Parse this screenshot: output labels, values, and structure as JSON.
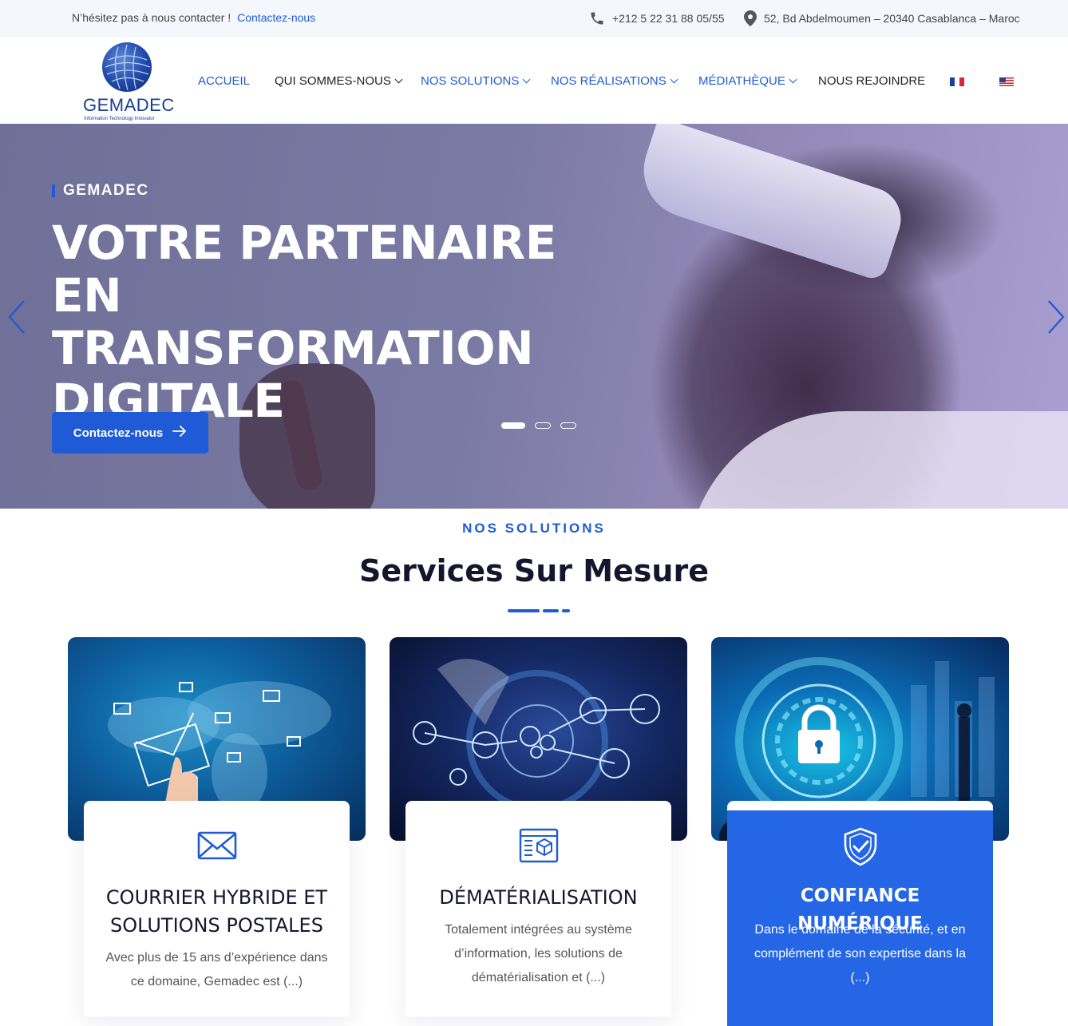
{
  "topbar": {
    "contact_prompt": "N’hésitez pas à nous contacter !",
    "contact_link": "Contactez-nous",
    "phone": "+212 5 22 31 88 05/55",
    "address": "52, Bd Abdelmoumen – 20340 Casablanca – Maroc",
    "icons": [
      "phone-icon",
      "map-pin-icon"
    ]
  },
  "logo": {
    "name": "GEMADEC",
    "tagline": "Information Technology Innovator"
  },
  "nav": {
    "items": [
      {
        "label": "ACCUEIL",
        "dropdown": false
      },
      {
        "label": "QUI SOMMES-NOUS",
        "dropdown": true
      },
      {
        "label": "NOS SOLUTIONS",
        "dropdown": true
      },
      {
        "label": "NOS RÉALISATIONS",
        "dropdown": true
      },
      {
        "label": "MÉDIATHÈQUE",
        "dropdown": true
      },
      {
        "label": "NOUS REJOINDRE",
        "dropdown": false
      }
    ],
    "languages": [
      "fr-flag",
      "us-flag"
    ]
  },
  "hero": {
    "kicker": "GEMADEC",
    "headline": [
      "VOTRE PARTENAIRE",
      "EN TRANSFORMATION",
      "DIGITALE"
    ],
    "cta_label": "Contactez-nous",
    "slides_total": 3,
    "active_slide": 1
  },
  "solutions": {
    "kicker": "NOS SOLUTIONS",
    "title": "Services Sur Mesure",
    "cards": [
      {
        "icon": "envelope-icon",
        "title": "COURRIER HYBRIDE ET SOLUTIONS POSTALES",
        "text": "Avec plus de 15 ans d’expérience dans ce domaine, Gemadec est (...)"
      },
      {
        "icon": "document-cube-icon",
        "title": "DÉMATÉRIALISATION",
        "text": "Totalement intégrées au système d’information, les solutions de dématérialisation et (...)"
      },
      {
        "icon": "shield-check-icon",
        "title": "CONFIANCE NUMÉRIQUE",
        "text": "Dans le domaine de la sécurité, et en complément de son expertise dans la (...)"
      }
    ]
  },
  "colors": {
    "accent": "#1f5bd6",
    "highlight_card": "#2466e6",
    "dark_text": "#15152e",
    "topbar_bg": "#f4f7fc"
  }
}
